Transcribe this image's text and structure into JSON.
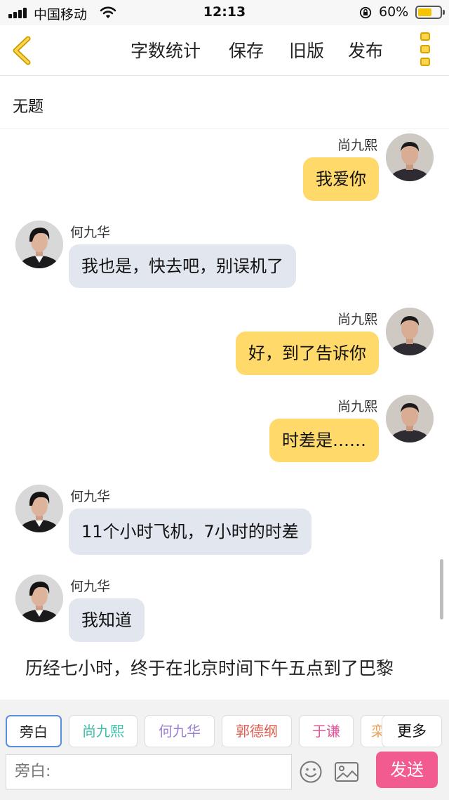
{
  "status_bar": {
    "carrier": "中国移动",
    "time": "12:13",
    "battery_percent": "60%",
    "battery_level": 0.6
  },
  "nav": {
    "items": [
      "字数统计",
      "保存",
      "旧版",
      "发布"
    ]
  },
  "document": {
    "title": "无题"
  },
  "messages": [
    {
      "side": "right",
      "sender": "尚九熙",
      "text": "我爱你"
    },
    {
      "side": "left",
      "sender": "何九华",
      "text": "我也是，快去吧，别误机了"
    },
    {
      "side": "right",
      "sender": "尚九熙",
      "text": "好，到了告诉你"
    },
    {
      "side": "right",
      "sender": "尚九熙",
      "text": "时差是……"
    },
    {
      "side": "left",
      "sender": "何九华",
      "text": "11个小时飞机，7小时的时差"
    },
    {
      "side": "left",
      "sender": "何九华",
      "text": "我知道"
    }
  ],
  "narration": "历经七小时，终于在北京时间下午五点到了巴黎",
  "roles": [
    {
      "label": "旁白",
      "color": "#222222",
      "active": true
    },
    {
      "label": "尚九熙",
      "color": "#3bbfa8",
      "active": false
    },
    {
      "label": "何九华",
      "color": "#9b7fd0",
      "active": false
    },
    {
      "label": "郭德纲",
      "color": "#e05a4e",
      "active": false
    },
    {
      "label": "于谦",
      "color": "#e0569a",
      "active": false
    },
    {
      "label": "栾",
      "color": "#e8a05a",
      "active": false
    }
  ],
  "more_roles_label": "更多",
  "input": {
    "placeholder": "旁白:"
  },
  "send_label": "发送",
  "colors": {
    "accent_yellow": "#ffd96a",
    "received_bubble": "#e2e6ee",
    "send_button": "#f25b8f"
  }
}
